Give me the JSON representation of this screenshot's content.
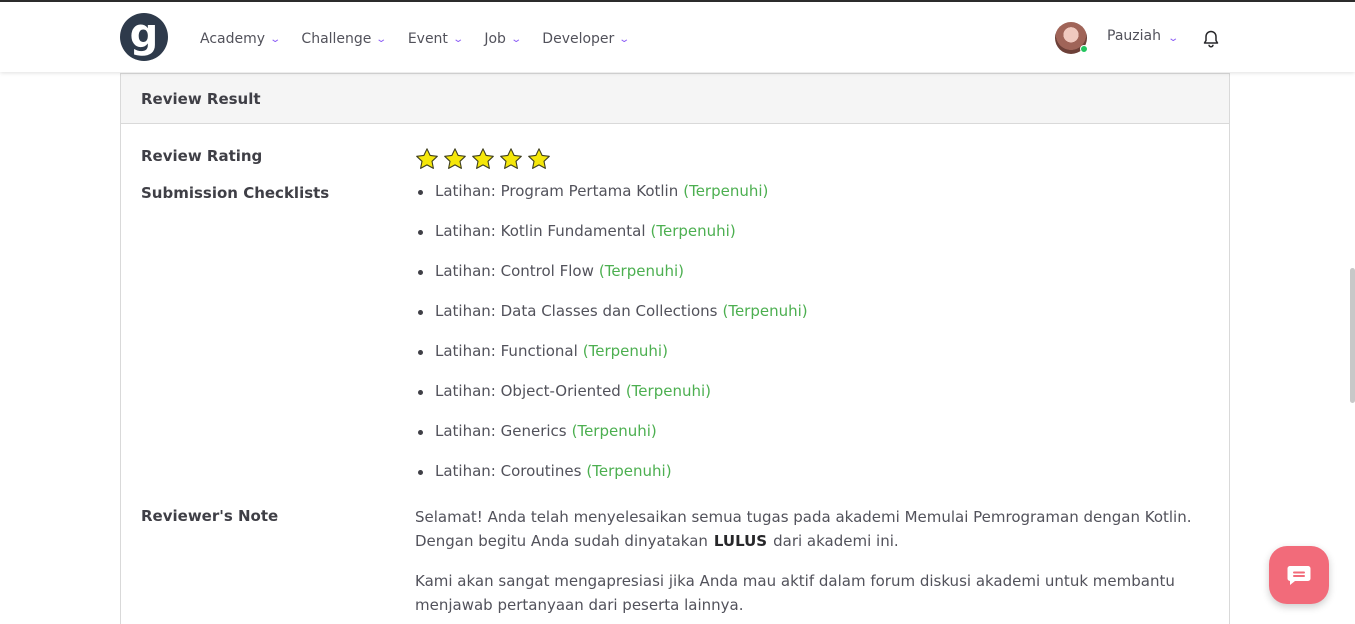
{
  "header": {
    "logo_letter": "g",
    "menu": [
      {
        "label": "Academy"
      },
      {
        "label": "Challenge"
      },
      {
        "label": "Event"
      },
      {
        "label": "Job"
      },
      {
        "label": "Developer"
      }
    ],
    "user": {
      "name": "Pauziah",
      "status": "online"
    },
    "icons": {
      "menu_chevron": "chevron-down-icon",
      "notifications": "bell-icon"
    },
    "accent_color": "#8b5cf6"
  },
  "review": {
    "title": "Review Result",
    "rating_label": "Review Rating",
    "rating": 5,
    "rating_max": 5,
    "checklist_label": "Submission Checklists",
    "checklist": [
      {
        "name": "Latihan: Program Pertama Kotlin",
        "status": "(Terpenuhi)"
      },
      {
        "name": "Latihan: Kotlin Fundamental",
        "status": "(Terpenuhi)"
      },
      {
        "name": "Latihan: Control Flow",
        "status": "(Terpenuhi)"
      },
      {
        "name": "Latihan: Data Classes dan Collections",
        "status": "(Terpenuhi)"
      },
      {
        "name": "Latihan: Functional",
        "status": "(Terpenuhi)"
      },
      {
        "name": "Latihan: Object-Oriented",
        "status": "(Terpenuhi)"
      },
      {
        "name": "Latihan: Generics",
        "status": "(Terpenuhi)"
      },
      {
        "name": "Latihan: Coroutines",
        "status": "(Terpenuhi)"
      }
    ],
    "status_color": "#4caf50",
    "note_label": "Reviewer's Note",
    "note": {
      "p1_before": "Selamat! Anda telah menyelesaikan semua tugas pada akademi Memulai Pemrograman dengan Kotlin. Dengan begitu Anda sudah dinyatakan",
      "p1_bold": "LULUS",
      "p1_after": "dari akademi ini.",
      "p2": "Kami akan sangat mengapresiasi jika Anda mau aktif dalam forum diskusi akademi untuk membantu menjawab pertanyaan dari peserta lainnya."
    }
  },
  "chat_widget": {
    "icon": "chat-icon",
    "color": "#f26b7a"
  }
}
